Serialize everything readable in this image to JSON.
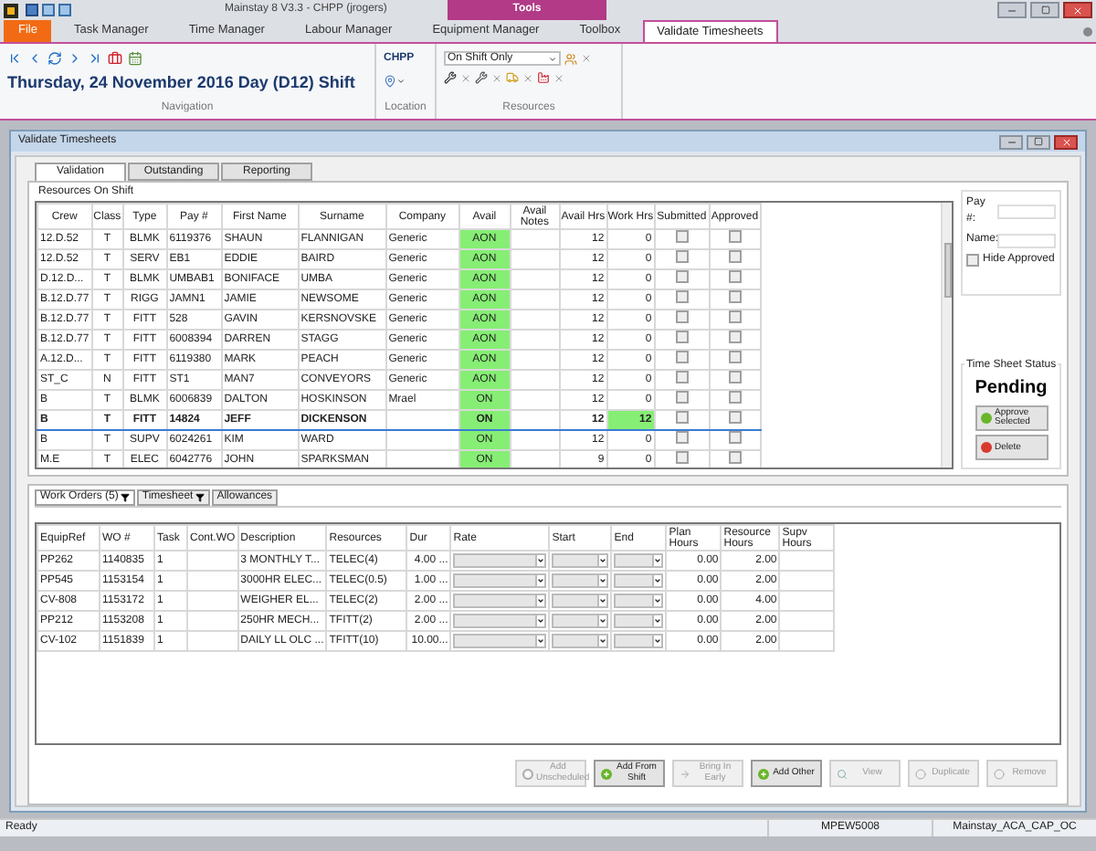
{
  "title_bar": {
    "title": "Mainstay 8 V3.3 - CHPP (jrogers)",
    "contextual_tab": "Tools"
  },
  "ribbon_tabs": [
    {
      "label": "File",
      "kind": "file",
      "selected": false
    },
    {
      "label": "Task Manager",
      "kind": "tab",
      "selected": false
    },
    {
      "label": "Time Manager",
      "kind": "tab",
      "selected": false
    },
    {
      "label": "Labour Manager",
      "kind": "tab",
      "selected": false
    },
    {
      "label": "Equipment Manager",
      "kind": "tab",
      "selected": false
    },
    {
      "label": "Toolbox",
      "kind": "tab",
      "selected": false
    },
    {
      "label": "Validate Timesheets",
      "kind": "tab",
      "selected": true
    }
  ],
  "ribbon": {
    "navigation": {
      "date_title": "Thursday, 24 November 2016 Day (D12) Shift",
      "group_label": "Navigation"
    },
    "location": {
      "site": "CHPP",
      "group_label": "Location"
    },
    "resources": {
      "filter": "On Shift Only",
      "group_label": "Resources"
    }
  },
  "window": {
    "title": "Validate Timesheets"
  },
  "tabs": [
    {
      "label": "Validation",
      "selected": true
    },
    {
      "label": "Outstanding",
      "selected": false
    },
    {
      "label": "Reporting",
      "selected": false
    }
  ],
  "resources": {
    "title": "Resources On Shift",
    "columns": [
      "Crew",
      "Class",
      "Type",
      "Pay #",
      "First Name",
      "Surname",
      "Company",
      "Avail",
      "Avail Notes",
      "Avail Hrs",
      "Work Hrs",
      "Submitted",
      "Approved"
    ],
    "rows": [
      {
        "crew": "12.D.52",
        "class": "T",
        "type": "BLMK",
        "pay": "6119376",
        "first": "SHAUN",
        "surname": "FLANNIGAN",
        "company": "Generic",
        "avail": "AON",
        "avail_hrs": "12",
        "work_hrs": "0",
        "submitted": false,
        "approved": false,
        "selected": false,
        "work_hrs_highlighted": false
      },
      {
        "crew": "12.D.52",
        "class": "T",
        "type": "SERV",
        "pay": "EB1",
        "first": "EDDIE",
        "surname": "BAIRD",
        "company": "Generic",
        "avail": "AON",
        "avail_hrs": "12",
        "work_hrs": "0",
        "submitted": false,
        "approved": false,
        "selected": false,
        "work_hrs_highlighted": false
      },
      {
        "crew": "D.12.D...",
        "class": "T",
        "type": "BLMK",
        "pay": "UMBAB1",
        "first": "BONIFACE",
        "surname": "UMBA",
        "company": "Generic",
        "avail": "AON",
        "avail_hrs": "12",
        "work_hrs": "0",
        "submitted": false,
        "approved": false,
        "selected": false,
        "work_hrs_highlighted": false
      },
      {
        "crew": "B.12.D.77",
        "class": "T",
        "type": "RIGG",
        "pay": "JAMN1",
        "first": "JAMIE",
        "surname": "NEWSOME",
        "company": "Generic",
        "avail": "AON",
        "avail_hrs": "12",
        "work_hrs": "0",
        "submitted": false,
        "approved": false,
        "selected": false,
        "work_hrs_highlighted": false
      },
      {
        "crew": "B.12.D.77",
        "class": "T",
        "type": "FITT",
        "pay": "528",
        "first": "GAVIN",
        "surname": "KERSNOVSKE",
        "company": "Generic",
        "avail": "AON",
        "avail_hrs": "12",
        "work_hrs": "0",
        "submitted": false,
        "approved": false,
        "selected": false,
        "work_hrs_highlighted": false
      },
      {
        "crew": "B.12.D.77",
        "class": "T",
        "type": "FITT",
        "pay": "6008394",
        "first": "DARREN",
        "surname": "STAGG",
        "company": "Generic",
        "avail": "AON",
        "avail_hrs": "12",
        "work_hrs": "0",
        "submitted": false,
        "approved": false,
        "selected": false,
        "work_hrs_highlighted": false
      },
      {
        "crew": "A.12.D...",
        "class": "T",
        "type": "FITT",
        "pay": "6119380",
        "first": "MARK",
        "surname": "PEACH",
        "company": "Generic",
        "avail": "AON",
        "avail_hrs": "12",
        "work_hrs": "0",
        "submitted": false,
        "approved": false,
        "selected": false,
        "work_hrs_highlighted": false
      },
      {
        "crew": "ST_C",
        "class": "N",
        "type": "FITT",
        "pay": "ST1",
        "first": "MAN7",
        "surname": "CONVEYORS",
        "company": "Generic",
        "avail": "AON",
        "avail_hrs": "12",
        "work_hrs": "0",
        "submitted": false,
        "approved": false,
        "selected": false,
        "work_hrs_highlighted": false
      },
      {
        "crew": "B",
        "class": "T",
        "type": "BLMK",
        "pay": "6006839",
        "first": "DALTON",
        "surname": "HOSKINSON",
        "company": "Mrael",
        "avail": "ON",
        "avail_hrs": "12",
        "work_hrs": "0",
        "submitted": false,
        "approved": false,
        "selected": false,
        "work_hrs_highlighted": false
      },
      {
        "crew": "B",
        "class": "T",
        "type": "FITT",
        "pay": "14824",
        "first": "JEFF",
        "surname": "DICKENSON",
        "avail": "ON",
        "avail_hrs": "12",
        "work_hrs": "12",
        "submitted": false,
        "approved": false,
        "selected": true,
        "work_hrs_highlighted": true
      },
      {
        "crew": "B",
        "class": "T",
        "type": "SUPV",
        "pay": "6024261",
        "first": "KIM",
        "surname": "WARD",
        "avail": "ON",
        "avail_hrs": "12",
        "work_hrs": "0",
        "submitted": false,
        "approved": false,
        "selected": false,
        "work_hrs_highlighted": false
      },
      {
        "crew": "M.E",
        "class": "T",
        "type": "ELEC",
        "pay": "6042776",
        "first": "JOHN",
        "surname": "SPARKSMAN",
        "avail": "ON",
        "avail_hrs": "9",
        "work_hrs": "0",
        "submitted": false,
        "approved": false,
        "selected": false,
        "work_hrs_highlighted": false
      }
    ]
  },
  "search_panel": {
    "pay_label": "Pay #:",
    "name_label": "Name:",
    "hide_approved": {
      "label": "Hide Approved",
      "checked": false
    }
  },
  "status_panel": {
    "title": "Time Sheet Status",
    "status": "Pending",
    "buttons": [
      {
        "label": "Approve Selected",
        "kind": "approve"
      },
      {
        "label": "Delete",
        "kind": "delete"
      }
    ]
  },
  "lower_tabs": [
    {
      "label": "Work Orders (5)",
      "filter": true,
      "selected": true
    },
    {
      "label": "Timesheet",
      "filter": true,
      "selected": false
    },
    {
      "label": "Allowances",
      "filter": false,
      "selected": false
    }
  ],
  "work_orders": {
    "columns": [
      "EquipRef",
      "WO #",
      "Task",
      "Cont.WO",
      "Description",
      "Resources",
      "Dur",
      "Rate",
      "Start",
      "End",
      "Plan Hours",
      "Resource Hours",
      "Supv Hours"
    ],
    "rows": [
      {
        "equip_ref": "PP262",
        "wo": "1140835",
        "task": "1",
        "description": "3 MONTHLY T...",
        "resources": "TELEC(4)",
        "dur": "4.00 ...",
        "plan_hours": "0.00",
        "resource_hours": "2.00"
      },
      {
        "equip_ref": "PP545",
        "wo": "1153154",
        "task": "1",
        "description": "3000HR ELEC...",
        "resources": "TELEC(0.5)",
        "dur": "1.00 ...",
        "plan_hours": "0.00",
        "resource_hours": "2.00"
      },
      {
        "equip_ref": "CV-808",
        "wo": "1153172",
        "task": "1",
        "description": "WEIGHER EL...",
        "resources": "TELEC(2)",
        "dur": "2.00 ...",
        "plan_hours": "0.00",
        "resource_hours": "4.00"
      },
      {
        "equip_ref": "PP212",
        "wo": "1153208",
        "task": "1",
        "description": "250HR MECH...",
        "resources": "TFITT(2)",
        "dur": "2.00 ...",
        "plan_hours": "0.00",
        "resource_hours": "2.00"
      },
      {
        "equip_ref": "CV-102",
        "wo": "1151839",
        "task": "1",
        "description": "DAILY LL OLC ...",
        "resources": "TFITT(10)",
        "dur": "10.00...",
        "plan_hours": "0.00",
        "resource_hours": "2.00"
      }
    ]
  },
  "action_buttons": [
    {
      "label": "Add Unscheduled",
      "kind": "add",
      "disabled": true
    },
    {
      "label": "Add From Shift",
      "kind": "add",
      "disabled": false
    },
    {
      "label": "Bring In Early",
      "kind": "bring",
      "disabled": true
    },
    {
      "label": "Add Other",
      "kind": "add",
      "disabled": false
    },
    {
      "label": "View",
      "kind": "view",
      "disabled": true
    },
    {
      "label": "Duplicate",
      "kind": "circle",
      "disabled": true
    },
    {
      "label": "Remove",
      "kind": "circle",
      "disabled": true
    }
  ],
  "status_bar": [
    "Ready",
    "MPEW5008",
    "Mainstay_ACA_CAP_OC"
  ]
}
